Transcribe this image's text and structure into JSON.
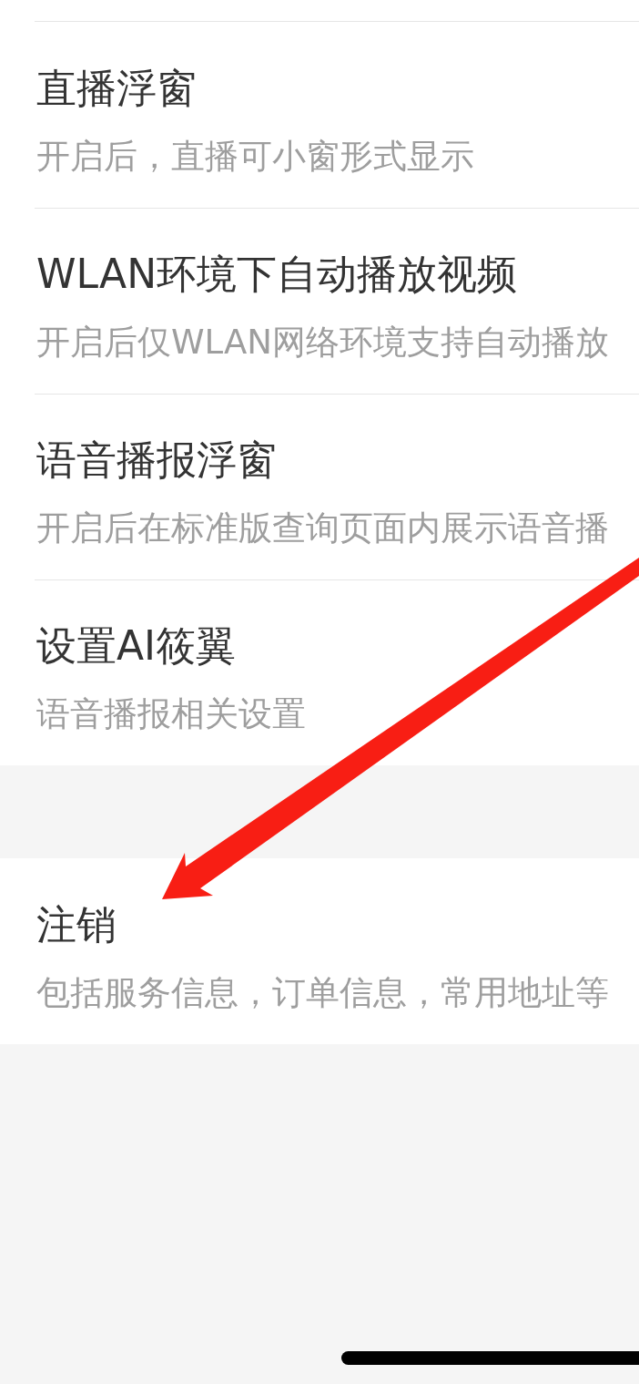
{
  "sections": [
    {
      "items": [
        {
          "title": "直播浮窗",
          "description": "开启后，直播可小窗形式显示"
        },
        {
          "title": "WLAN环境下自动播放视频",
          "description": "开启后仅WLAN网络环境支持自动播放"
        },
        {
          "title": "语音播报浮窗",
          "description": "开启后在标准版查询页面内展示语音播"
        },
        {
          "title": "设置AI筱翼",
          "description": "语音播报相关设置"
        }
      ]
    },
    {
      "items": [
        {
          "title": "注销",
          "description": "包括服务信息，订单信息，常用地址等"
        }
      ]
    }
  ]
}
